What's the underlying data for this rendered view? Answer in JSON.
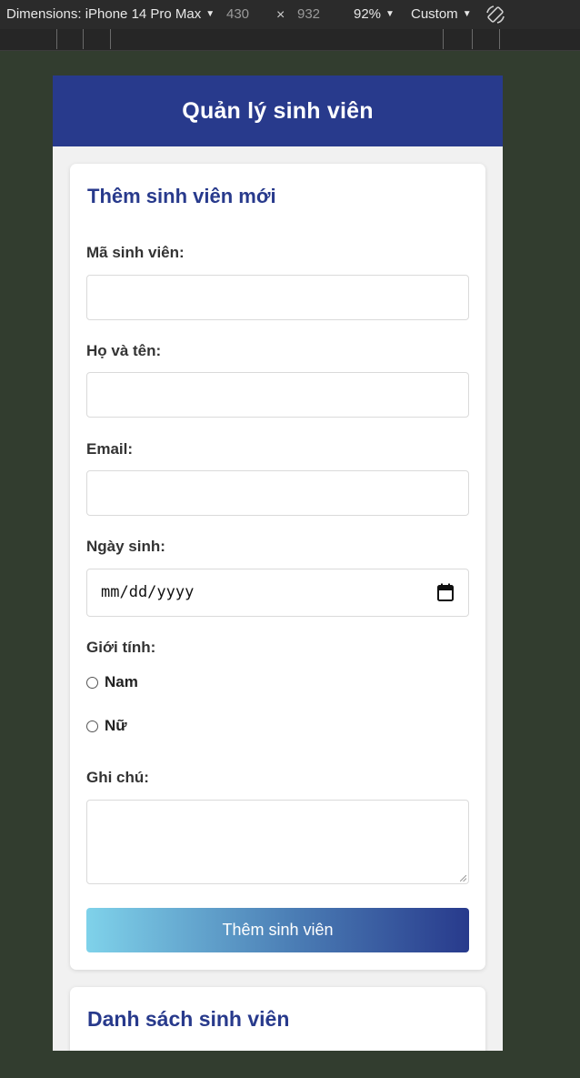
{
  "devtools": {
    "device_label": "Dimensions: iPhone 14 Pro Max",
    "width": "430",
    "times": "×",
    "height": "932",
    "zoom": "92%",
    "throttle": "Custom"
  },
  "app": {
    "title": "Quản lý sinh viên"
  },
  "form": {
    "title": "Thêm sinh viên mới",
    "student_id_label": "Mã sinh viên:",
    "student_id_value": "",
    "full_name_label": "Họ và tên:",
    "full_name_value": "",
    "email_label": "Email:",
    "email_value": "",
    "dob_label": "Ngày sinh:",
    "dob_placeholder": "mm/dd/yyyy",
    "gender_label": "Giới tính:",
    "gender_options": [
      "Nam",
      "Nữ"
    ],
    "note_label": "Ghi chú:",
    "submit_label": "Thêm sinh viên"
  },
  "list": {
    "title": "Danh sách sinh viên"
  },
  "colors": {
    "primary": "#283a8c",
    "gradient_start": "#7fd2ea",
    "page_bg": "#323d2f"
  }
}
